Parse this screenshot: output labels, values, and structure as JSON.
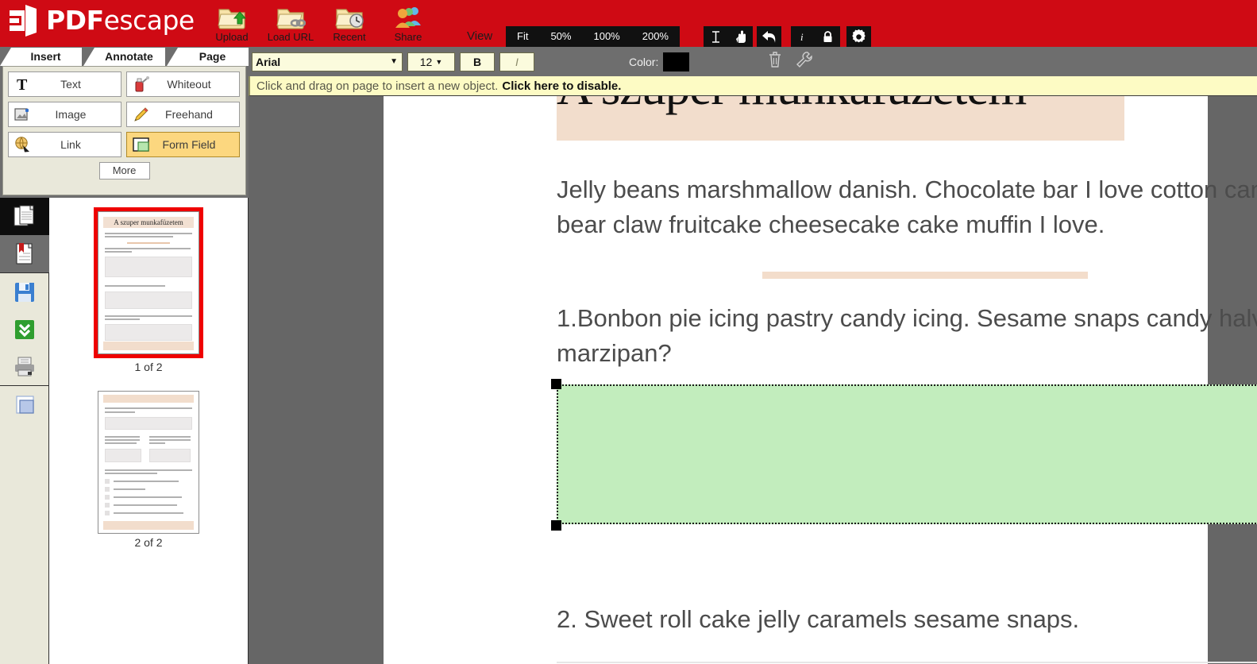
{
  "brand": {
    "name_bold": "PDF",
    "name_thin": "escape",
    "bar_color": "#cf0a14"
  },
  "topbar": {
    "actions": [
      {
        "label": "Upload",
        "icon": "folder-upload-icon"
      },
      {
        "label": "Load URL",
        "icon": "folder-link-icon"
      },
      {
        "label": "Recent",
        "icon": "folder-clock-icon"
      },
      {
        "label": "Share",
        "icon": "share-people-icon"
      }
    ],
    "view_label": "View",
    "zoom_buttons": [
      "Fit",
      "50%",
      "100%",
      "200%"
    ],
    "tool_icons": [
      "text-cursor-icon",
      "hand-pointer-icon",
      "undo-icon",
      "info-icon",
      "lock-icon",
      "gear-icon"
    ]
  },
  "tabs": [
    {
      "label": "Insert",
      "active": true
    },
    {
      "label": "Annotate",
      "active": false
    },
    {
      "label": "Page",
      "active": false
    }
  ],
  "insert_panel": {
    "buttons": [
      {
        "label": "Text",
        "icon": "text-T-icon",
        "active": false
      },
      {
        "label": "Whiteout",
        "icon": "whiteout-bottle-icon",
        "active": false
      },
      {
        "label": "Image",
        "icon": "image-add-icon",
        "active": false
      },
      {
        "label": "Freehand",
        "icon": "pencil-icon",
        "active": false
      },
      {
        "label": "Link",
        "icon": "link-globe-icon",
        "active": false
      },
      {
        "label": "Form Field",
        "icon": "form-field-icon",
        "active": true
      }
    ],
    "more_label": "More"
  },
  "format_bar": {
    "font_family": "Arial",
    "font_size": "12",
    "bold_label": "B",
    "italic_label": "I",
    "color_label": "Color:",
    "color_value": "#000000",
    "trash_icon": "trash-icon",
    "wrench_icon": "wrench-icon"
  },
  "hint_bar": {
    "text": "Click and drag on page to insert a new object.",
    "action_text": "Click here to disable."
  },
  "sidebar_icons": [
    {
      "name": "pages-icon",
      "state": "active"
    },
    {
      "name": "bookmark-icon",
      "state": "hover"
    },
    {
      "name": "save-disk-icon",
      "state": "normal"
    },
    {
      "name": "download-icon",
      "state": "normal"
    },
    {
      "name": "print-icon",
      "state": "normal"
    },
    {
      "name": "properties-window-icon",
      "state": "normal"
    }
  ],
  "thumbnails": [
    {
      "caption": "1 of 2",
      "title": "A szuper munkafüzetem",
      "selected": true
    },
    {
      "caption": "2 of 2",
      "title": "",
      "selected": false
    }
  ],
  "document": {
    "title": "A szuper munkafüzetem",
    "paragraph": "Jelly beans marshmallow danish. Chocolate bar I love cotton candy bear claw fruitcake cheesecake cake muffin I love.",
    "question_1": "1.Bonbon pie icing pastry candy icing. Sesame snaps candy halvah marzipan?",
    "question_2": "2. Sweet roll cake jelly caramels sesame snaps.",
    "form_field_color": "#c2edbd",
    "title_highlight_color": "#f2ddcc"
  }
}
